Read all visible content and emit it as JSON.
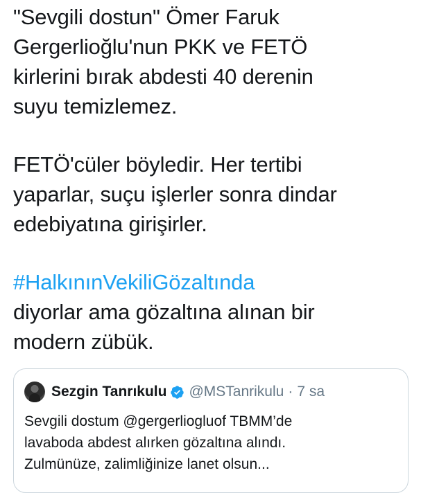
{
  "tweet": {
    "paragraphs": [
      {
        "lines": [
          "\"Sevgili dostun\" Ömer Faruk",
          "Gergerlioğlu'nun PKK ve FETÖ",
          "kirlerini bırak abdesti 40 derenin",
          "suyu temizlemez."
        ]
      },
      {
        "lines": [
          "FETÖ'cüler böyledir. Her tertibi",
          "yaparlar, suçu işlerler sonra dindar",
          "edebiyatına girişirler."
        ]
      }
    ],
    "hashtag": "#HalkınınVekiliGözaltında",
    "closing_lines": [
      "diyorlar ama gözaltına alınan bir",
      "modern zübük."
    ]
  },
  "quoted_tweet": {
    "author_name": "Sezgin Tanrıkulu",
    "handle": "@MSTanrikulu",
    "separator": "·",
    "time": "7 sa",
    "verified_icon": "verified-badge-icon",
    "lines": [
      "Sevgili dostum @gergerliogluof  TBMM’de",
      "lavaboda abdest alırken gözaltına alındı.",
      "Zulmünüze, zalimliğinize lanet olsun..."
    ]
  },
  "colors": {
    "text": "#14171a",
    "hashtag": "#1da1f2",
    "secondary": "#657786",
    "border": "#ccd6dd",
    "verified": "#1da1f2"
  }
}
